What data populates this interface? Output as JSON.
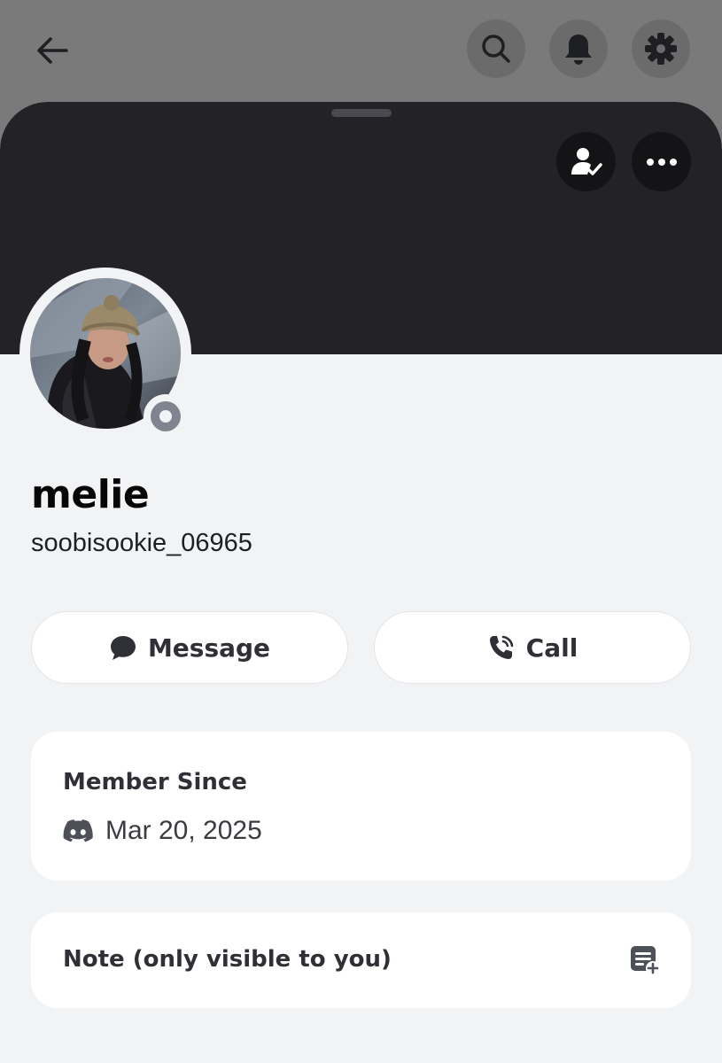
{
  "topbar": {
    "icons": [
      "arrow-left-icon",
      "search-icon",
      "bell-icon",
      "gear-icon"
    ]
  },
  "banner": {
    "color": "#232226",
    "icons": [
      "friend-check-icon",
      "more-horizontal-icon"
    ]
  },
  "profile": {
    "display_name": "melie",
    "username": "soobisookie_06965",
    "status": "offline",
    "status_color": "#80848e"
  },
  "actions": {
    "message_label": "Message",
    "call_label": "Call"
  },
  "member_since": {
    "title": "Member Since",
    "icon": "discord-icon",
    "date": "Mar 20, 2025"
  },
  "note": {
    "title": "Note (only visible to you)",
    "icon": "add-note-icon"
  },
  "colors": {
    "sheet_background": "#f2f3f5",
    "card_background": "#ffffff",
    "overlay": "#7a7a7a"
  }
}
